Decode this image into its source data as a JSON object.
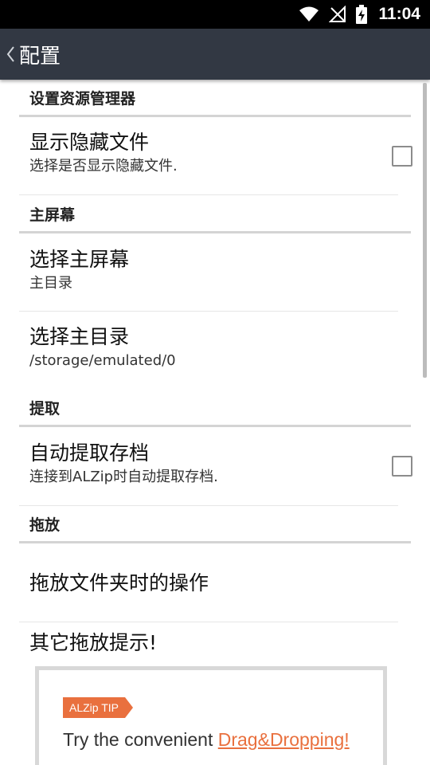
{
  "status_bar": {
    "time": "11:04",
    "icons": [
      "wifi-icon",
      "no-signal-icon",
      "battery-charging-icon"
    ]
  },
  "app_bar": {
    "back_icon": "chevron-left-icon",
    "title": "配置"
  },
  "sections": {
    "explorer": {
      "header": "设置资源管理器",
      "show_hidden": {
        "title": "显示隐藏文件",
        "summary": "选择是否显示隐藏文件.",
        "checked": false
      }
    },
    "home": {
      "header": "主屏幕",
      "select_home": {
        "title": "选择主屏幕",
        "summary": "主目录"
      },
      "select_home_dir": {
        "title": "选择主目录",
        "summary": "/storage/emulated/0"
      }
    },
    "extract": {
      "header": "提取",
      "auto_extract": {
        "title": "自动提取存档",
        "summary": "连接到ALZip时自动提取存档.",
        "checked": false
      }
    },
    "drag_drop": {
      "header": "拖放",
      "folder_action": {
        "title": "拖放文件夹时的操作"
      },
      "other_tips": {
        "title": "其它拖放提示!"
      }
    }
  },
  "tip": {
    "badge": "ALZip TIP",
    "text_prefix": "Try the convenient ",
    "text_highlight": "Drag&Dropping!"
  },
  "colors": {
    "status_bar": "#000000",
    "app_bar": "#323843",
    "accent": "#e9703e",
    "divider": "#d4d4d4"
  }
}
